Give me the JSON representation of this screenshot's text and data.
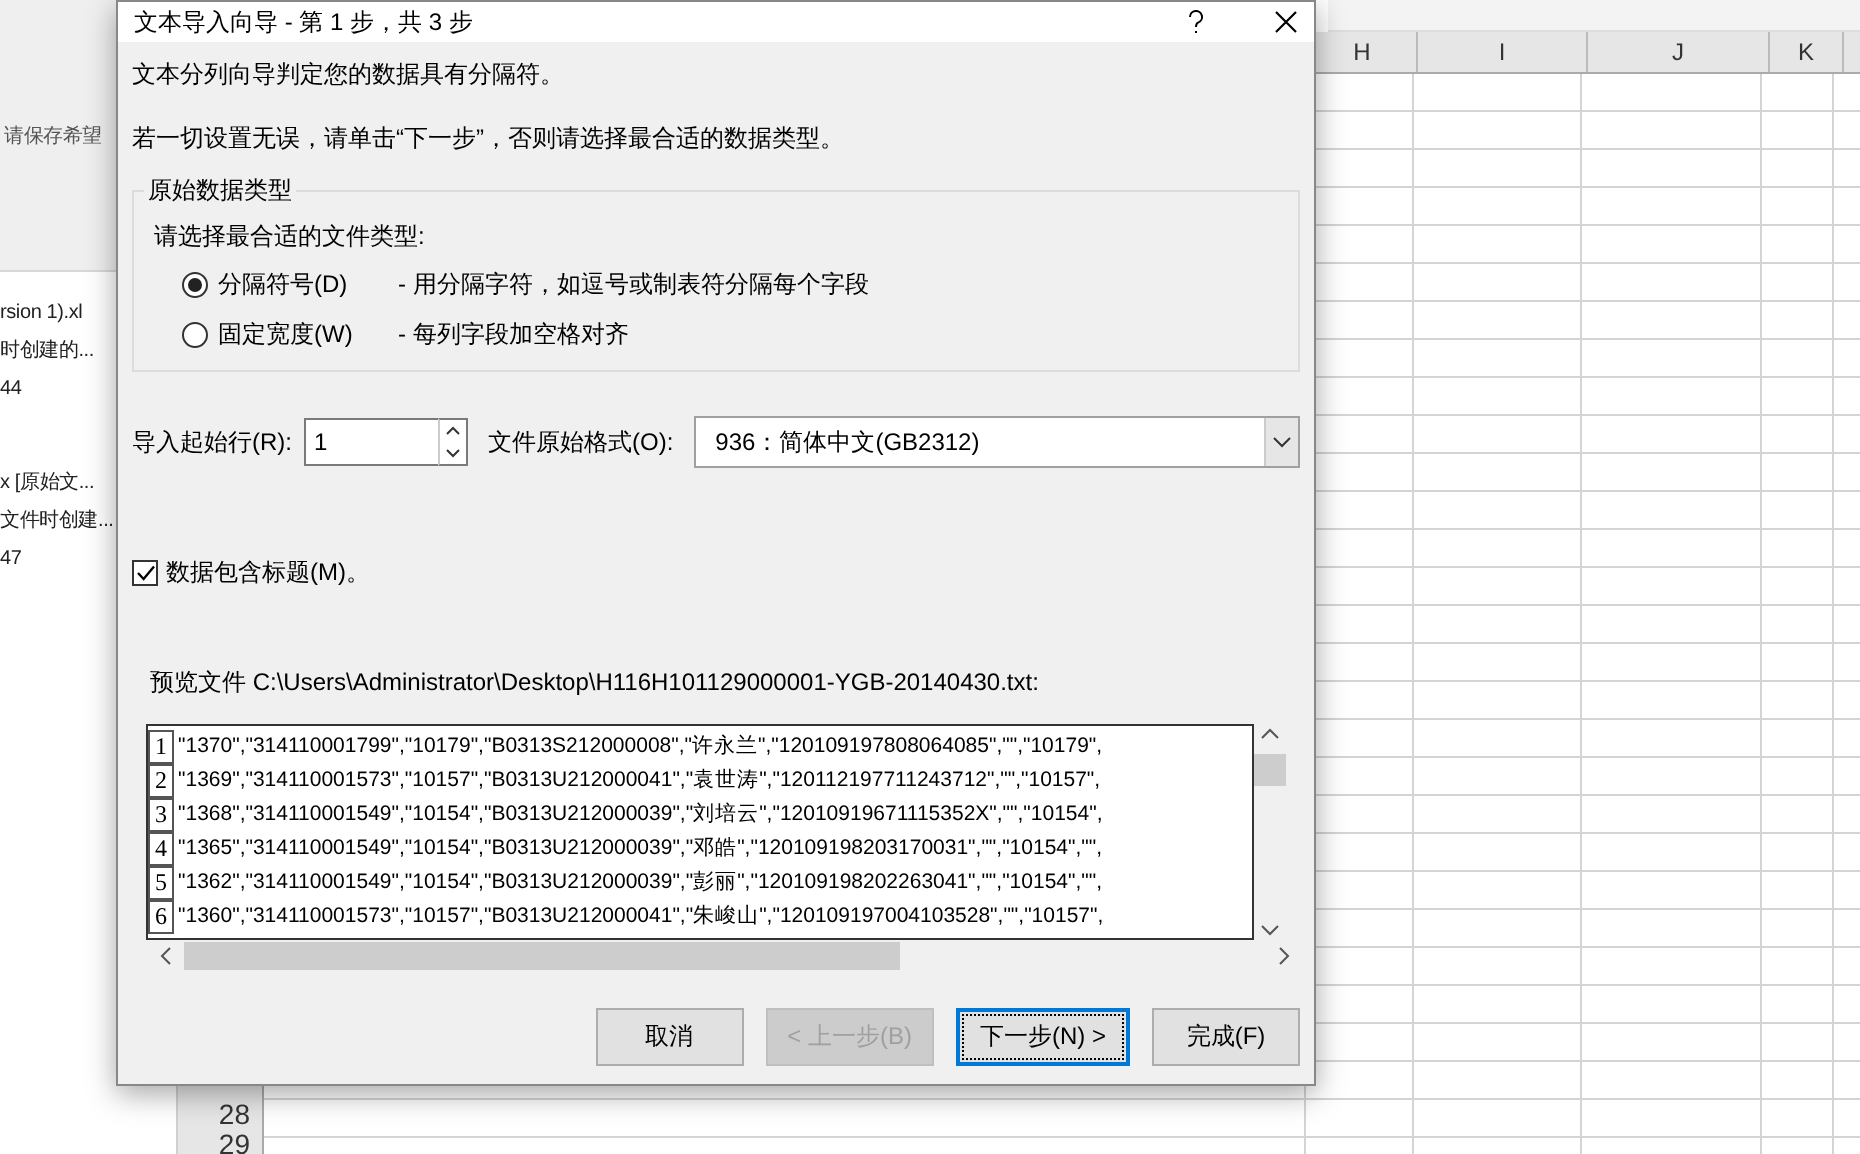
{
  "background": {
    "left_panel": {
      "banner_text": "请保存希望",
      "items": [
        {
          "lines": [
            "rsion 1).xl",
            "时创建的...",
            "44"
          ]
        },
        {
          "lines": [
            "x  [原始文...",
            "文件时创建...",
            "47"
          ]
        }
      ]
    },
    "sheet": {
      "columns": [
        "H",
        "I",
        "J",
        "K"
      ],
      "row_numbers": [
        "28",
        "29"
      ]
    }
  },
  "dialog": {
    "title": "文本导入向导 - 第 1 步，共 3 步",
    "intro": "文本分列向导判定您的数据具有分隔符。",
    "hint": "若一切设置无误，请单击“下一步”，否则请选择最合适的数据类型。",
    "data_type": {
      "legend": "原始数据类型",
      "prompt": "请选择最合适的文件类型:",
      "options": [
        {
          "label": "分隔符号(D)",
          "description": "- 用分隔字符，如逗号或制表符分隔每个字段",
          "selected": true
        },
        {
          "label": "固定宽度(W)",
          "description": "- 每列字段加空格对齐",
          "selected": false
        }
      ]
    },
    "start_row": {
      "label": "导入起始行(R):",
      "value": "1"
    },
    "file_origin": {
      "label": "文件原始格式(O):",
      "value": "936：简体中文(GB2312)"
    },
    "has_headers": {
      "label": "数据包含标题(M)。",
      "checked": true
    },
    "preview": {
      "label": "预览文件 C:\\Users\\Administrator\\Desktop\\H116H101129000001-YGB-20140430.txt:",
      "rows": [
        {
          "number": "1",
          "text": "\"1370\",\"314110001799\",\"10179\",\"B0313S212000008\",\"许永兰\",\"120109197808064085\",\"\",\"10179\","
        },
        {
          "number": "2",
          "text": "\"1369\",\"314110001573\",\"10157\",\"B0313U212000041\",\"袁世涛\",\"120112197711243712\",\"\",\"10157\","
        },
        {
          "number": "3",
          "text": "\"1368\",\"314110001549\",\"10154\",\"B0313U212000039\",\"刘培云\",\"12010919671115352X\",\"\",\"10154\","
        },
        {
          "number": "4",
          "text": "\"1365\",\"314110001549\",\"10154\",\"B0313U212000039\",\"邓皓\",\"120109198203170031\",\"\",\"10154\",\"\","
        },
        {
          "number": "5",
          "text": "\"1362\",\"314110001549\",\"10154\",\"B0313U212000039\",\"彭丽\",\"120109198202263041\",\"\",\"10154\",\"\","
        },
        {
          "number": "6",
          "text": "\"1360\",\"314110001573\",\"10157\",\"B0313U212000041\",\"朱峻山\",\"120109197004103528\",\"\",\"10157\","
        }
      ]
    },
    "buttons": [
      {
        "label": "取消",
        "disabled": false,
        "default": false
      },
      {
        "label": "< 上一步(B)",
        "disabled": true,
        "default": false
      },
      {
        "label": "下一步(N) >",
        "disabled": false,
        "default": true
      },
      {
        "label": "完成(F)",
        "disabled": false,
        "default": false
      }
    ]
  }
}
